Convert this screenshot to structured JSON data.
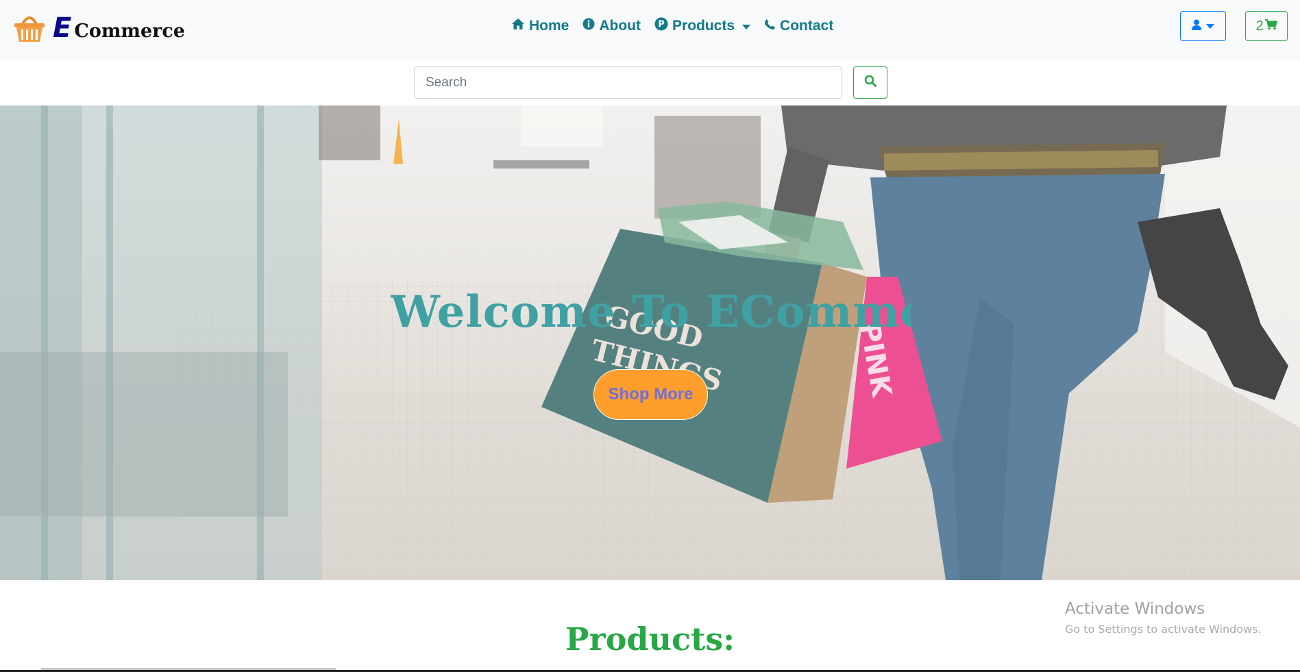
{
  "brand": {
    "initial": "E",
    "name": "Commerce",
    "logo_icon": "basket-icon"
  },
  "nav": [
    {
      "label": "Home",
      "icon": "home-icon"
    },
    {
      "label": "About",
      "icon": "info-icon"
    },
    {
      "label": "Products",
      "icon": "p-circle-icon",
      "dropdown": true
    },
    {
      "label": "Contact",
      "icon": "phone-icon"
    }
  ],
  "user_menu": {
    "icon": "user-icon",
    "dropdown": true
  },
  "cart": {
    "count": "2",
    "icon": "cart-icon"
  },
  "search": {
    "placeholder": "Search",
    "value": "",
    "button_icon": "search-icon"
  },
  "hero": {
    "title": "Welcome To EComme",
    "button_label": "Shop More"
  },
  "products": {
    "heading": "Products:"
  },
  "watermark": {
    "title": "Activate Windows",
    "subtitle": "Go to Settings to activate Windows."
  },
  "colors": {
    "nav_link": "#117a8b",
    "accent_orange": "#fd9e2c",
    "success": "#28a745",
    "primary": "#007bff",
    "hero_title": "#3fa1a3"
  }
}
